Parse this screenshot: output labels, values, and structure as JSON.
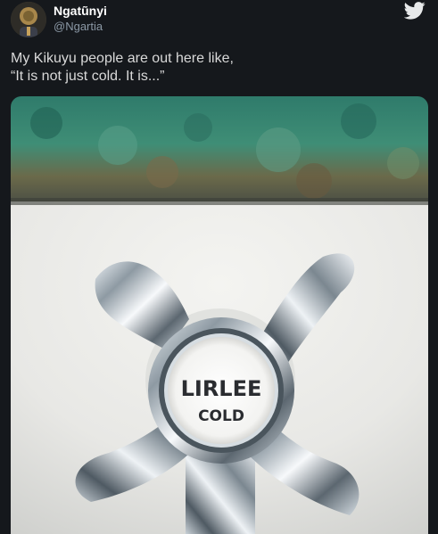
{
  "author": {
    "display_name": "Ngatũnyi",
    "handle": "@Ngartia",
    "avatar_icon": "avatar-photo"
  },
  "tweet": {
    "text_line1": "My Kikuyu people are out here like,",
    "text_line2": "“It is not just cold. It is...”"
  },
  "media": {
    "label_brand": "LIRLEE",
    "label_word": "COLD",
    "icon": "faucet-photo"
  },
  "icons": {
    "brand": "twitter-bird-icon"
  },
  "colors": {
    "background": "#15181c",
    "text": "#d9d9d9",
    "muted": "#8b98a5"
  }
}
